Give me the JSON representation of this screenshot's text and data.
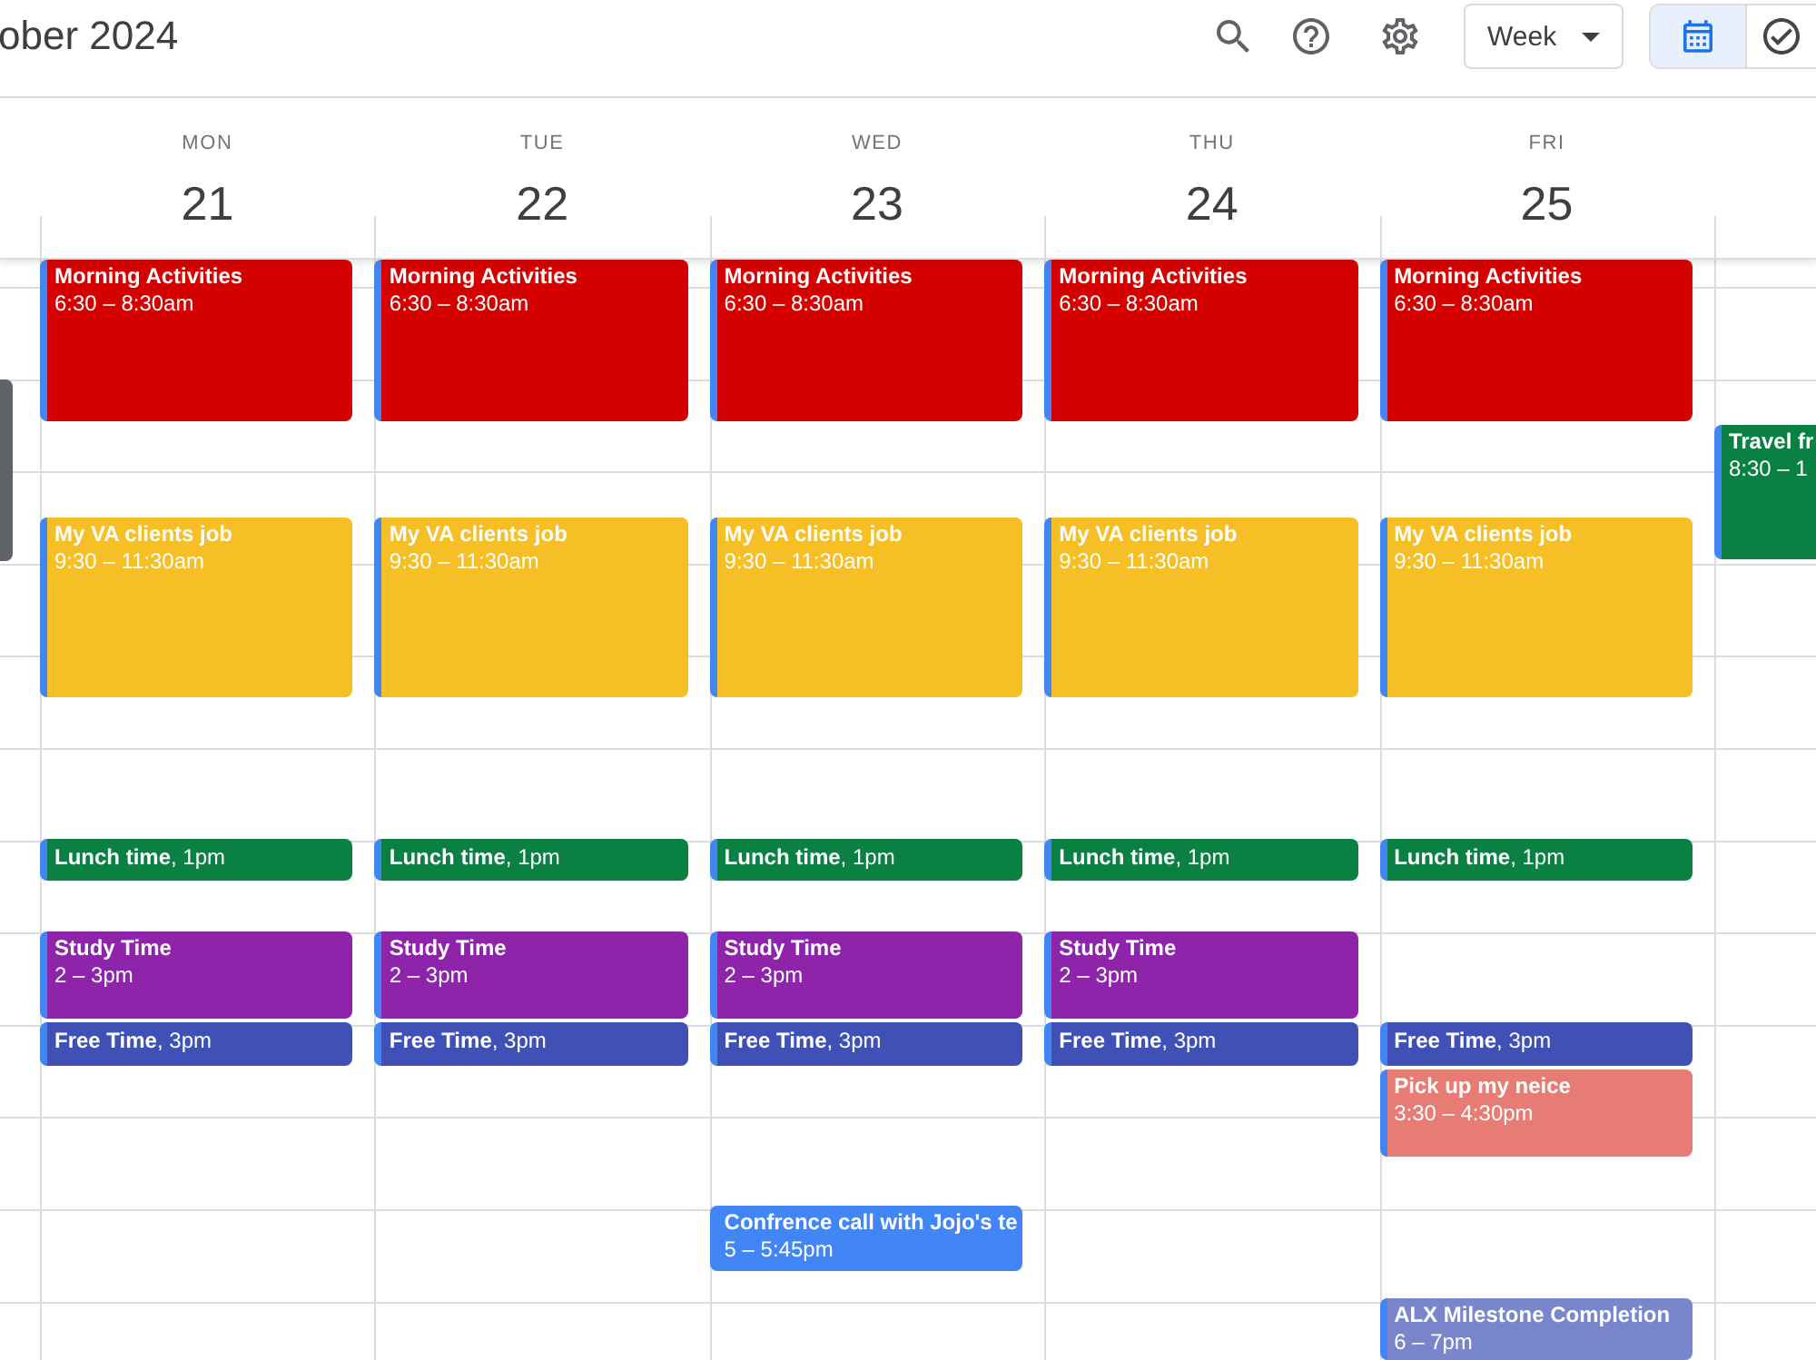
{
  "header": {
    "title": "ober 2024",
    "view_menu": {
      "label": "Week"
    },
    "view_toggle": [
      {
        "selected": true
      },
      {
        "selected": false
      }
    ]
  },
  "days": [
    {
      "name": "MON",
      "number": "21",
      "events": [
        {
          "kind": "stacked",
          "title": "Morning Activities",
          "time": "6:30 – 8:30am",
          "color": "#d50000"
        },
        {
          "kind": "stacked",
          "title": "My VA clients job",
          "time": "9:30 – 11:30am",
          "color": "#f6bf26"
        },
        {
          "kind": "inline",
          "text": "**Lunch time**, 1pm",
          "color": "#0b8043"
        },
        {
          "kind": "stacked",
          "title": "Study Time",
          "time": "2 – 3pm",
          "color": "#8e24aa"
        },
        {
          "kind": "inline",
          "text": "**Free Time**, 3pm",
          "color": "#3f51b5"
        }
      ]
    },
    {
      "name": "TUE",
      "number": "22",
      "events": [
        {
          "kind": "stacked",
          "title": "Morning Activities",
          "time": "6:30 – 8:30am",
          "color": "#d50000"
        },
        {
          "kind": "stacked",
          "title": "My VA clients job",
          "time": "9:30 – 11:30am",
          "color": "#f6bf26"
        },
        {
          "kind": "inline",
          "text": "**Lunch time**, 1pm",
          "color": "#0b8043"
        },
        {
          "kind": "stacked",
          "title": "Study Time",
          "time": "2 – 3pm",
          "color": "#8e24aa"
        },
        {
          "kind": "inline",
          "text": "**Free Time**, 3pm",
          "color": "#3f51b5"
        }
      ]
    },
    {
      "name": "WED",
      "number": "23",
      "events": [
        {
          "kind": "stacked",
          "title": "Morning Activities",
          "time": "6:30 – 8:30am",
          "color": "#d50000"
        },
        {
          "kind": "stacked",
          "title": "My VA clients job",
          "time": "9:30 – 11:30am",
          "color": "#f6bf26"
        },
        {
          "kind": "inline",
          "text": "**Lunch time**, 1pm",
          "color": "#0b8043"
        },
        {
          "kind": "stacked",
          "title": "Study Time",
          "time": "2 – 3pm",
          "color": "#8e24aa"
        },
        {
          "kind": "inline",
          "text": "**Free Time**, 3pm",
          "color": "#3f51b5"
        },
        {
          "kind": "stacked",
          "title": "Confrence call with Jojo's te",
          "time": "5 – 5:45pm",
          "color": "#4285f4"
        }
      ]
    },
    {
      "name": "THU",
      "number": "24",
      "events": [
        {
          "kind": "stacked",
          "title": "Morning Activities",
          "time": "6:30 – 8:30am",
          "color": "#d50000"
        },
        {
          "kind": "stacked",
          "title": "My VA clients job",
          "time": "9:30 – 11:30am",
          "color": "#f6bf26"
        },
        {
          "kind": "inline",
          "text": "**Lunch time**, 1pm",
          "color": "#0b8043"
        },
        {
          "kind": "stacked",
          "title": "Study Time",
          "time": "2 – 3pm",
          "color": "#8e24aa"
        },
        {
          "kind": "inline",
          "text": "**Free Time**, 3pm",
          "color": "#3f51b5"
        }
      ]
    },
    {
      "name": "FRI",
      "number": "25",
      "events": [
        {
          "kind": "stacked",
          "title": "Morning Activities",
          "time": "6:30 – 8:30am",
          "color": "#d50000"
        },
        {
          "kind": "stacked",
          "title": "My VA clients job",
          "time": "9:30 – 11:30am",
          "color": "#f6bf26"
        },
        {
          "kind": "inline",
          "text": "**Lunch time**, 1pm",
          "color": "#0b8043"
        },
        {
          "kind": "inline",
          "text": "**Free Time**, 3pm",
          "color": "#3f51b5"
        },
        {
          "kind": "stacked",
          "title": "Pick up my neice",
          "time": "3:30 – 4:30pm",
          "color": "#e67c73"
        },
        {
          "kind": "stacked",
          "title": "ALX Milestone Completion",
          "time": "6 – 7pm",
          "color": "#7986cb"
        }
      ]
    },
    {
      "events": [
        {
          "kind": "stacked",
          "title": "Travel fr",
          "time": "8:30 – 1",
          "color": "#0b8043"
        }
      ]
    }
  ]
}
